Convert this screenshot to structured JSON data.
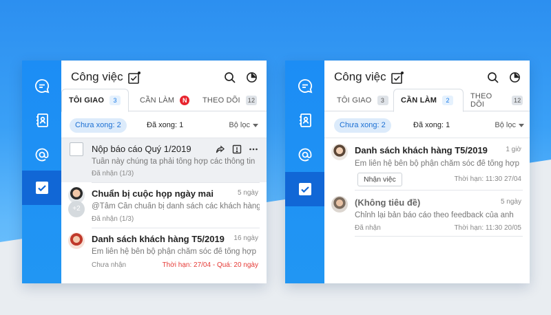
{
  "colors": {
    "accent": "#2196f3",
    "rail_active": "#1167d6",
    "chip_bg": "#dcebfb",
    "deadline_red": "#e53935",
    "badge_red": "#e8252f"
  },
  "icons": [
    "chat-icon",
    "contacts-icon",
    "mention-icon",
    "todo-check-icon",
    "task-add-icon",
    "search-icon",
    "report-pie-icon"
  ],
  "left": {
    "title": "Công việc",
    "tabs": [
      {
        "label": "TÔI GIAO",
        "badge": "3",
        "active": true
      },
      {
        "label": "CẦN LÀM",
        "badge": "N",
        "active": false
      },
      {
        "label": "THEO DÕI",
        "badge": "12",
        "active": false
      }
    ],
    "filter": {
      "pending": "Chưa xong: 2",
      "done": "Đã xong: 1",
      "filter_label": "Bộ lọc"
    },
    "tasks": [
      {
        "title": "Nộp báo cáo Quý 1/2019",
        "sub": "Tuần này chúng ta phải tổng hợp các thông tin",
        "meta": "Đã nhận (1/3)"
      },
      {
        "title": "Chuẩn bị cuộc họp ngày mai",
        "time": "5 ngày",
        "sub": "@Tâm Cần chuẩn bị danh sách các khách hàng",
        "meta": "Đã nhận (1/3)",
        "extra": "+2"
      },
      {
        "title": "Danh sách khách hàng T5/2019",
        "time": "16 ngày",
        "sub": "Em liên hệ bên bộ phận chăm sóc để tổng hợp",
        "meta": "Chưa nhận",
        "deadline": "Thời hạn: 27/04 - Quá: 20 ngày"
      }
    ]
  },
  "right": {
    "title": "Công việc",
    "tabs": [
      {
        "label": "TÔI GIAO",
        "badge": "3",
        "active": false
      },
      {
        "label": "CẦN LÀM",
        "badge": "2",
        "active": true
      },
      {
        "label": "THEO DÕI",
        "badge": "12",
        "active": false
      }
    ],
    "filter": {
      "pending": "Chưa xong: 2",
      "done": "Đã xong: 1",
      "filter_label": "Bộ lọc"
    },
    "tasks": [
      {
        "title": "Danh sách khách hàng T5/2019",
        "time": "1 giờ",
        "sub": "Em liên hệ bên bộ phận chăm sóc để tổng hợp",
        "button": "Nhận việc",
        "deadline": "Thời hạn: 11:30 27/04"
      },
      {
        "title": "(Không tiêu đề)",
        "time": "5 ngày",
        "sub": "Chỉnh lại bản báo cáo theo feedback của anh",
        "meta": "Đã nhận",
        "deadline": "Thời hạn: 11:30 20/05"
      }
    ]
  }
}
